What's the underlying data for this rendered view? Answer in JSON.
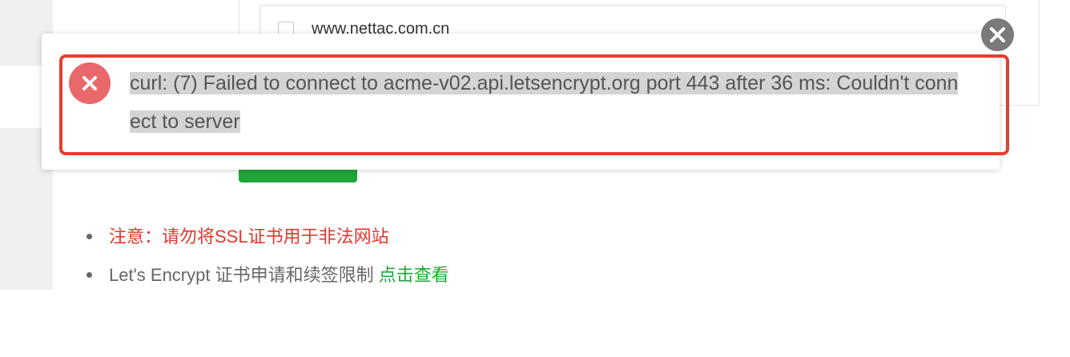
{
  "background_page": {
    "domain_item": "www.nettac.com.cn"
  },
  "toast": {
    "message": "curl: (7) Failed to connect to acme-v02.api.letsencrypt.org port 443 after 36 ms: Couldn't connect to server",
    "icon": "error-x-icon",
    "close_icon": "close-icon"
  },
  "notes": {
    "warning": "注意：请勿将SSL证书用于非法网站",
    "limits_text": "Let's Encrypt 证书申请和续签限制",
    "limits_link": "点击查看"
  },
  "colors": {
    "error_red": "#e9686b",
    "highlight_red": "#e53e2f",
    "warning_text": "#e2372d",
    "link_green": "#20a53a",
    "close_gray": "#7a7a7a"
  }
}
